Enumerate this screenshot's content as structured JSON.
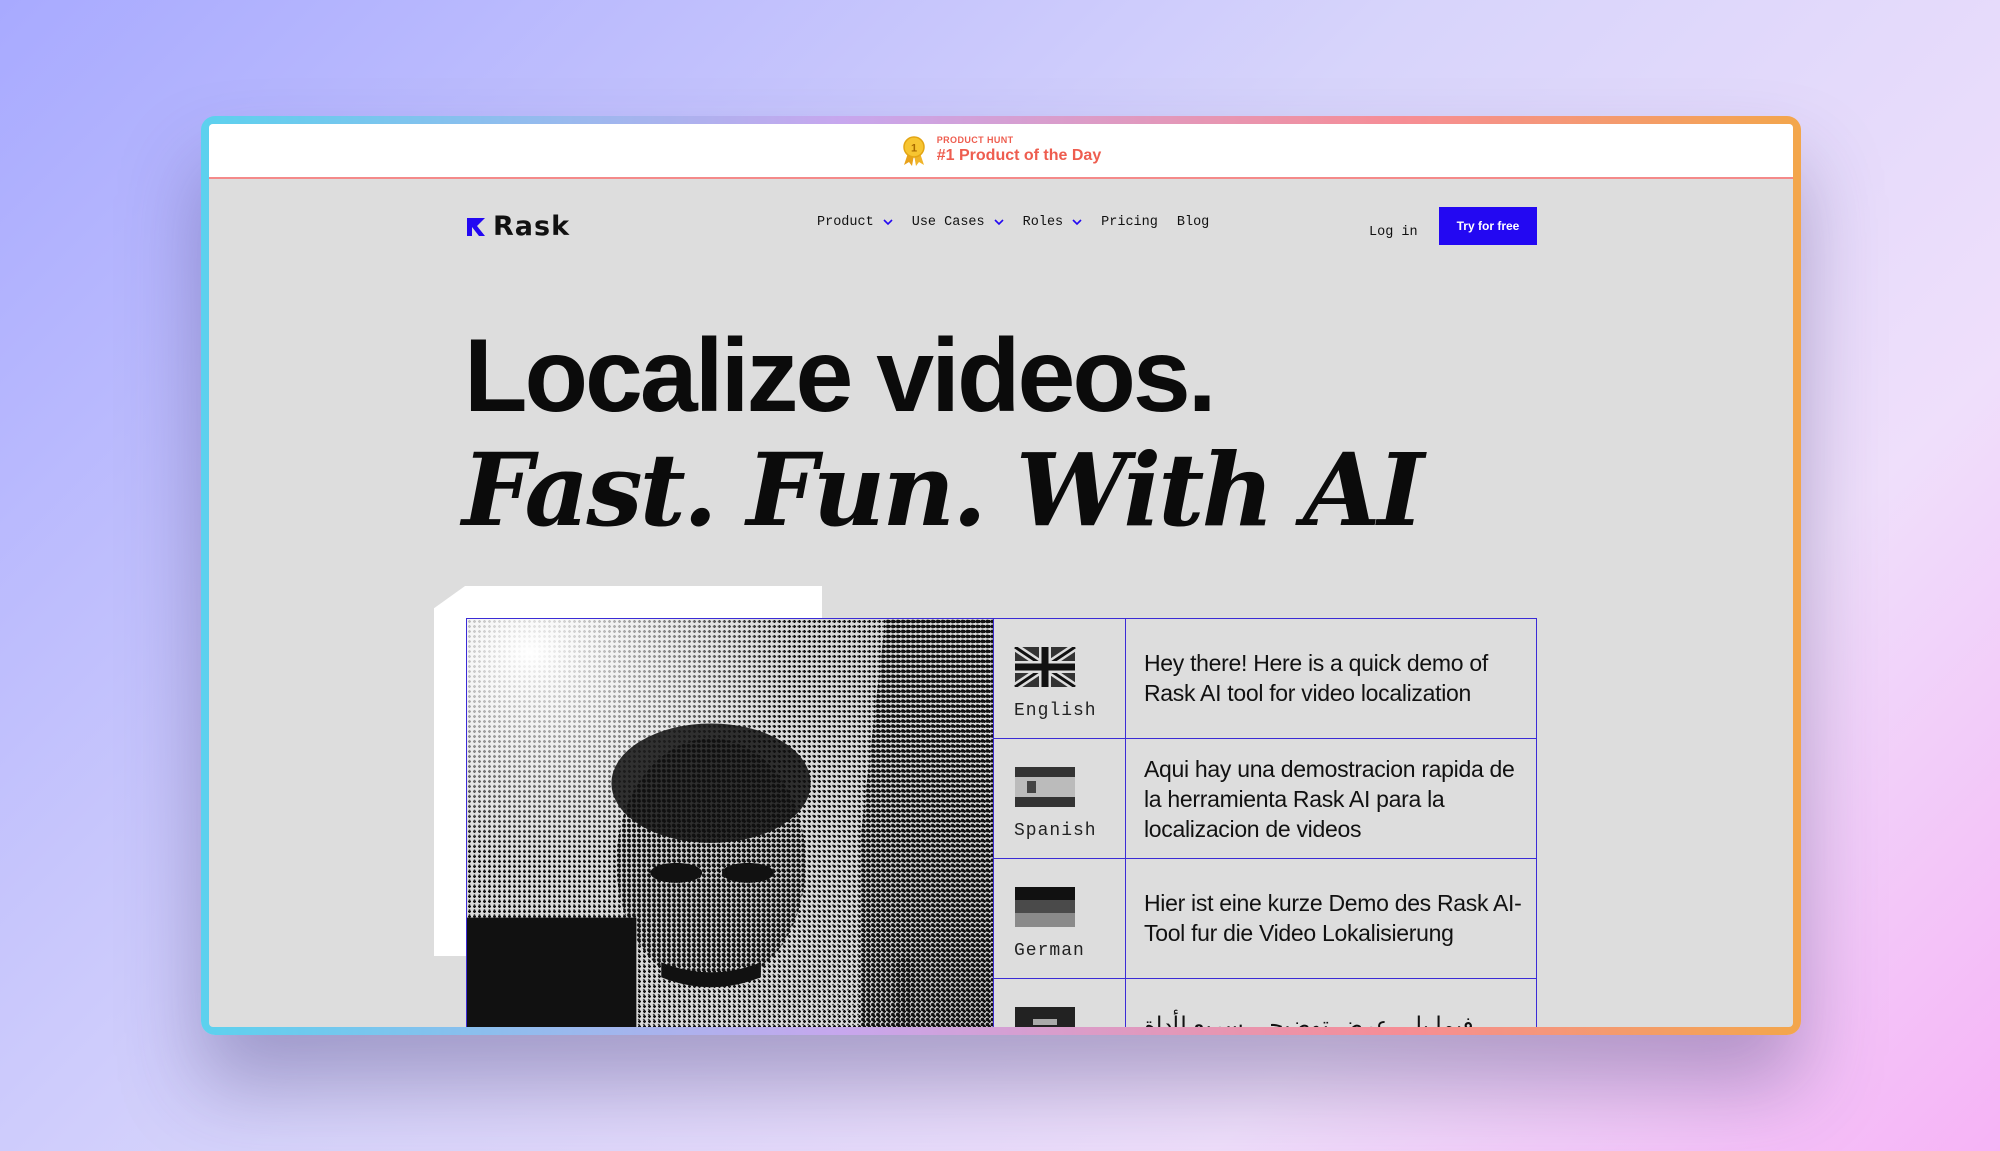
{
  "banner": {
    "label": "PRODUCT HUNT",
    "title": "#1 Product of the Day",
    "medal_number": "1"
  },
  "nav": {
    "logo_text": "Rask",
    "links": [
      {
        "label": "Product",
        "has_dropdown": true
      },
      {
        "label": "Use Cases",
        "has_dropdown": true
      },
      {
        "label": "Roles",
        "has_dropdown": true
      },
      {
        "label": "Pricing",
        "has_dropdown": false
      },
      {
        "label": "Blog",
        "has_dropdown": false
      }
    ],
    "login_label": "Log in",
    "cta_label": "Try for free"
  },
  "hero": {
    "line1": "Localize videos.",
    "line2": "Fast. Fun. With AI"
  },
  "demo": {
    "rows": [
      {
        "language": "English",
        "flag": "uk-flag",
        "text": "Hey there! Here is a quick demo of Rask AI tool for video localization"
      },
      {
        "language": "Spanish",
        "flag": "spain-flag",
        "text": "Aqui hay una demostracion rapida de la herramienta Rask AI para la localizacion de videos"
      },
      {
        "language": "German",
        "flag": "germany-flag",
        "text": "Hier ist eine kurze Demo des Rask AI-Tool fur die Video Lokalisierung"
      },
      {
        "language": "",
        "flag": "saudi-flag",
        "text": "فيما يلي عرض توضيحي سريع لأداة"
      }
    ]
  },
  "colors": {
    "accent": "#2308f2",
    "banner_text": "#ee5d4f",
    "table_border": "#3b2bd6",
    "page_bg": "#dddddd"
  }
}
